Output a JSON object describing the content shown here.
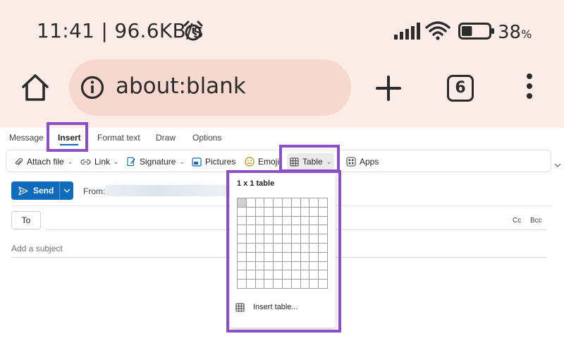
{
  "status_bar": {
    "time_speed": "11:41 | 96.6KB/s",
    "battery_percent": "38",
    "battery_unit": "%",
    "battery_level": 0.38,
    "icons": [
      "alarm-icon",
      "signal-icon",
      "wifi-icon",
      "battery-icon"
    ]
  },
  "browser": {
    "url": "about:blank",
    "tab_count": "6",
    "icons": [
      "home-icon",
      "info-icon",
      "plus-icon",
      "kebab-menu-icon"
    ]
  },
  "ribbon": {
    "tabs": [
      {
        "label": "Message",
        "active": false
      },
      {
        "label": "Insert",
        "active": true
      },
      {
        "label": "Format text",
        "active": false
      },
      {
        "label": "Draw",
        "active": false
      },
      {
        "label": "Options",
        "active": false
      }
    ],
    "toolbar": {
      "attach_file": "Attach file",
      "link": "Link",
      "signature": "Signature",
      "pictures": "Pictures",
      "emoji": "Emoji",
      "table": "Table",
      "apps": "Apps"
    }
  },
  "compose": {
    "send_label": "Send",
    "from_label": "From:",
    "to_label": "To",
    "cc_label": "Cc",
    "bcc_label": "Bcc",
    "subject_placeholder": "Add a subject"
  },
  "table_dropdown": {
    "title": "1 x 1 table",
    "grid_rows": 10,
    "grid_cols": 10,
    "selected_rows": 1,
    "selected_cols": 1,
    "insert_label": "Insert table..."
  },
  "colors": {
    "chrome_bg": "#fbece7",
    "url_bar_bg": "#f7d8cf",
    "accent": "#0f6cbd",
    "highlight": "#8d4fc5"
  }
}
